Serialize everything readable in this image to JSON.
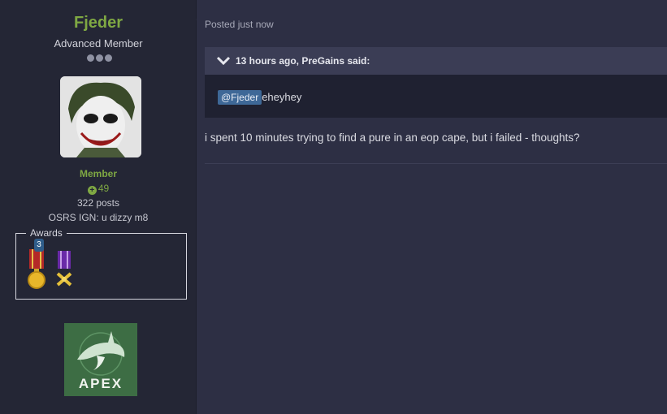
{
  "author": {
    "username": "Fjeder",
    "rank_title": "Advanced Member",
    "group": "Member",
    "reputation": "49",
    "post_count": "322 posts",
    "custom_field": "OSRS IGN: u dizzy m8",
    "awards_label": "Awards",
    "awards": [
      {
        "name": "red-ribbon-gold-medal",
        "count": "3"
      },
      {
        "name": "purple-ribbon-crossed-swords",
        "count": ""
      }
    ],
    "signature_logo_text": "APEX"
  },
  "post": {
    "meta": "Posted just now",
    "quote_citation": "13 hours ago, PreGains said:",
    "quote_mention": "@Fjeder",
    "quote_text": "eheyhey",
    "body": "i spent 10 minutes trying to find a pure in an eop cape, but i failed - thoughts?"
  },
  "colors": {
    "accent_green": "#7fa843",
    "mention_blue": "#3e6897",
    "background": "#2d2f44",
    "panel": "#242635"
  }
}
